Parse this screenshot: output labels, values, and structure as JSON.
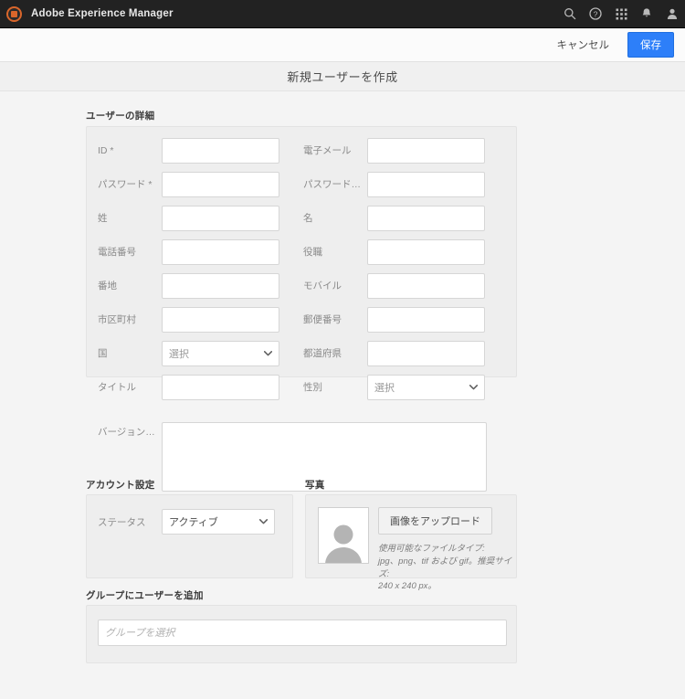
{
  "topbar": {
    "brand": "Adobe Experience Manager",
    "logo_icon": "aem-logo-icon",
    "icons": [
      {
        "name": "search-icon",
        "label": "検索"
      },
      {
        "name": "help-icon",
        "label": "ヘルプ"
      },
      {
        "name": "solutions-grid-icon",
        "label": "ソリューション"
      },
      {
        "name": "notifications-bell-icon",
        "label": "通知"
      },
      {
        "name": "user-avatar-icon",
        "label": "ユーザー"
      }
    ]
  },
  "actionbar": {
    "cancel_label": "キャンセル",
    "save_label": "保存",
    "save_bg": "#2d7ff9"
  },
  "page": {
    "title": "新規ユーザーを作成"
  },
  "user_details": {
    "heading": "ユーザーの詳細",
    "left_fields": [
      {
        "label": "ID *",
        "type": "text",
        "value": "",
        "placeholder": ""
      },
      {
        "label": "パスワード *",
        "type": "text",
        "value": "",
        "placeholder": ""
      },
      {
        "label": "姓",
        "type": "text",
        "value": "",
        "placeholder": ""
      },
      {
        "label": "電話番号",
        "type": "text",
        "value": "",
        "placeholder": ""
      },
      {
        "label": "番地",
        "type": "text",
        "value": "",
        "placeholder": ""
      },
      {
        "label": "市区町村",
        "type": "text",
        "value": "",
        "placeholder": ""
      },
      {
        "label": "国",
        "type": "select",
        "value": "選択",
        "is_placeholder": true
      },
      {
        "label": "タイトル",
        "type": "text",
        "value": "",
        "placeholder": ""
      }
    ],
    "right_fields": [
      {
        "label": "電子メール",
        "type": "text",
        "value": "",
        "placeholder": ""
      },
      {
        "label": "パスワードの確…",
        "type": "text",
        "value": "",
        "placeholder": ""
      },
      {
        "label": "名",
        "type": "text",
        "value": "",
        "placeholder": ""
      },
      {
        "label": "役職",
        "type": "text",
        "value": "",
        "placeholder": ""
      },
      {
        "label": "モバイル",
        "type": "text",
        "value": "",
        "placeholder": ""
      },
      {
        "label": "郵便番号",
        "type": "text",
        "value": "",
        "placeholder": ""
      },
      {
        "label": "都道府県",
        "type": "text",
        "value": "",
        "placeholder": ""
      },
      {
        "label": "性別",
        "type": "select",
        "value": "選択",
        "is_placeholder": true
      }
    ],
    "bio": {
      "label": "バージョン情報",
      "value": "",
      "placeholder": ""
    }
  },
  "account_settings": {
    "heading": "アカウント設定",
    "status_label": "ステータス",
    "status_value": "アクティブ"
  },
  "photo": {
    "heading": "写真",
    "avatar_icon": "user-placeholder-avatar-icon",
    "upload_label": "画像をアップロード",
    "hint_line1": "使用可能なファイルタイプ:",
    "hint_line2": "jpg、png、tif および gif。推奨サイズ:",
    "hint_line3": "240 x 240 px。"
  },
  "groups": {
    "heading": "グループにユーザーを追加",
    "value": "",
    "placeholder": "グループを選択"
  }
}
